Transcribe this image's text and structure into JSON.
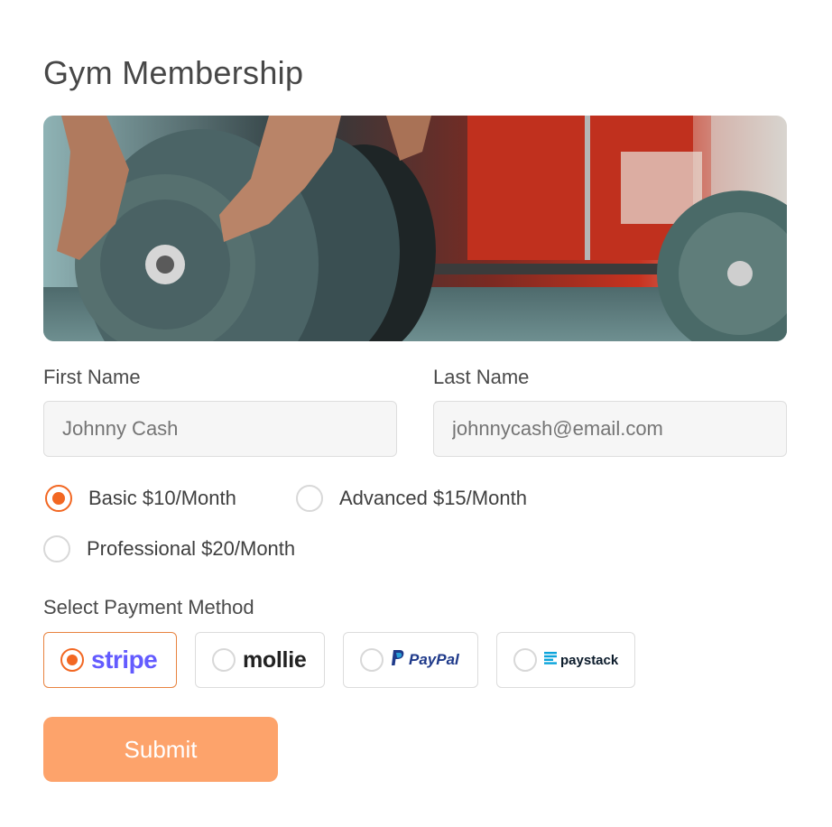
{
  "form": {
    "title": "Gym Membership",
    "first_name": {
      "label": "First Name",
      "placeholder": "Johnny Cash"
    },
    "last_name": {
      "label": "Last Name",
      "placeholder": "johnnycash@email.com"
    },
    "plans": [
      {
        "label": "Basic $10/Month",
        "selected": true
      },
      {
        "label": "Advanced $15/Month",
        "selected": false
      },
      {
        "label": "Professional $20/Month",
        "selected": false
      }
    ],
    "payment": {
      "label": "Select Payment Method",
      "methods": [
        {
          "name": "stripe",
          "selected": true
        },
        {
          "name": "mollie",
          "selected": false
        },
        {
          "name": "PayPal",
          "selected": false
        },
        {
          "name": "paystack",
          "selected": false
        }
      ]
    },
    "submit_label": "Submit"
  },
  "colors": {
    "accent": "#f26722",
    "submit_bg": "#fda36b",
    "stripe": "#635bff",
    "paypal_dark": "#1f3a8a",
    "paypal_light": "#2a9fd6",
    "paystack": "#0ba4db"
  }
}
